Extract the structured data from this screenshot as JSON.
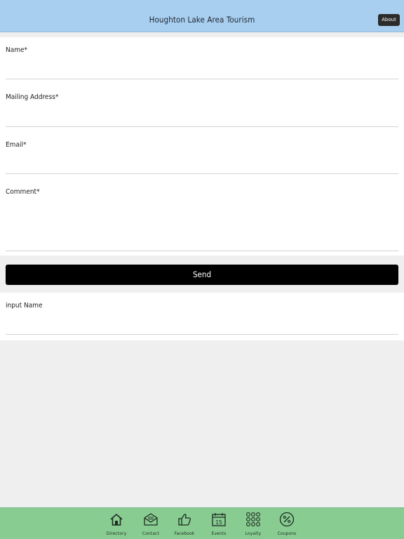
{
  "header": {
    "title": "Houghton Lake Area Tourism",
    "about_label": "About"
  },
  "form": {
    "fields": [
      {
        "label": "Name*",
        "value": ""
      },
      {
        "label": "Mailing Address*",
        "value": ""
      },
      {
        "label": "Email*",
        "value": ""
      },
      {
        "label": "Comment*",
        "value": ""
      }
    ],
    "send_label": "Send",
    "extra_field": {
      "label": "input Name",
      "value": ""
    }
  },
  "tabbar": {
    "items": [
      {
        "label": "Directory",
        "icon": "home-icon"
      },
      {
        "label": "Contact",
        "icon": "envelope-icon"
      },
      {
        "label": "Facebook",
        "icon": "thumbs-up-icon"
      },
      {
        "label": "Events",
        "icon": "calendar-icon",
        "icon_text": "15"
      },
      {
        "label": "Loyalty",
        "icon": "grid-dots-icon"
      },
      {
        "label": "Coupons",
        "icon": "percent-icon"
      }
    ]
  }
}
